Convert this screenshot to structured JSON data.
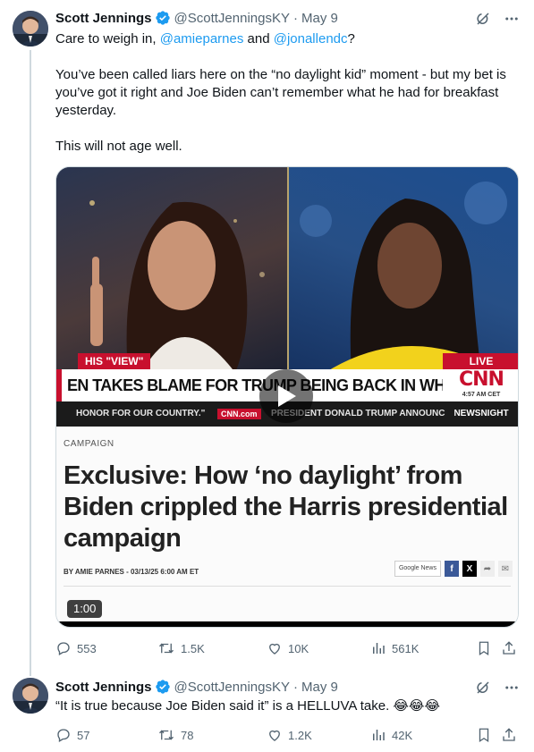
{
  "tweets": [
    {
      "name": "Scott Jennings",
      "handle": "@ScottJenningsKY",
      "date": "May 9",
      "text_intro": "Care to weigh in, ",
      "mention1": "@amieparnes",
      "text_and": " and ",
      "mention2": "@jonallendc",
      "text_q": "?",
      "para2": "You’ve been called liars here on the “no daylight kid” moment - but my bet is you’ve got it right and Joe Biden can’t remember what he had for breakfast yesterday.",
      "para3": "This will not age well.",
      "replies": "553",
      "reposts": "1.5K",
      "likes": "10K",
      "views": "561K"
    },
    {
      "name": "Scott Jennings",
      "handle": "@ScottJenningsKY",
      "date": "May 9",
      "text": "“It is true because Joe Biden said it” is a HELLUVA take. 😂😂😂",
      "replies": "57",
      "reposts": "78",
      "likes": "1.2K",
      "views": "42K"
    }
  ],
  "video": {
    "tag_left": "HIS \"VIEW\"",
    "tag_live": "LIVE",
    "headline": "EN TAKES BLAME FOR TRUMP BEING BACK IN WHITE HOUSE",
    "cnn_logo": "CNN",
    "cnn_time": "4:57 AM CET",
    "ticker_left": "HONOR FOR OUR COUNTRY.\"",
    "ticker_cnncom": "CNN.com",
    "ticker_mid": "PRESIDENT DONALD TRUMP ANNOUNC",
    "ticker_right": "NEWSNIGHT",
    "duration": "1:00",
    "progress_fraction": 0.0
  },
  "article": {
    "category": "CAMPAIGN",
    "title": "Exclusive: How ‘no daylight’ from Biden crippled the Harris presidential campaign",
    "byline": "BY AMIE PARNES - 03/13/25 6:00 AM ET",
    "google_news": "Google News",
    "fb": "f",
    "x": "X"
  },
  "icons": {
    "verified": "verified-badge-icon",
    "grok": "grok-icon",
    "more": "more-icon",
    "reply": "reply-icon",
    "repost": "repost-icon",
    "like": "like-icon",
    "views": "views-icon",
    "bookmark": "bookmark-icon",
    "share": "share-icon"
  },
  "colors": {
    "link": "#1d9bf0",
    "secondary_text": "#536471",
    "cnn_red": "#c8102e"
  }
}
